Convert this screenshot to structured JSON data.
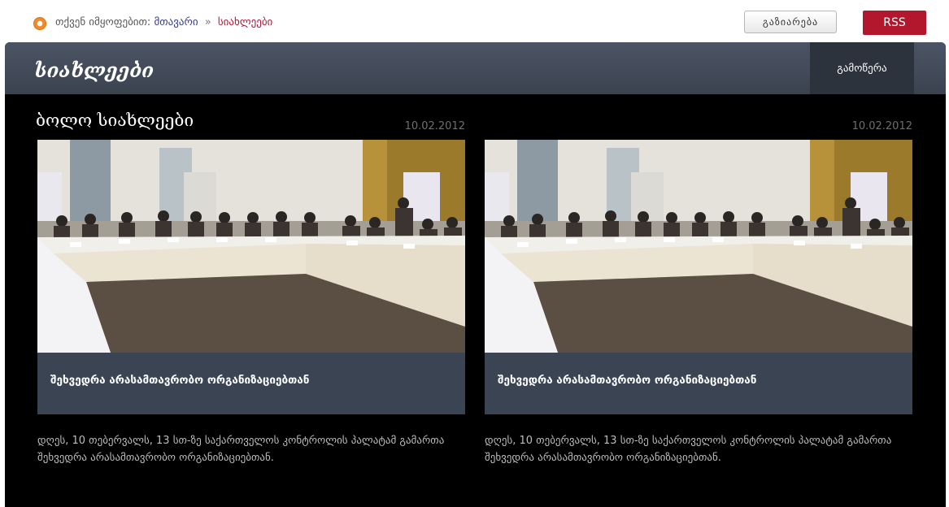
{
  "breadcrumb": {
    "prefix": "თქვენ იმყოფებით:",
    "home": "მთავარი",
    "separator": "»",
    "current": "სიახლეები"
  },
  "toolbar": {
    "share_label": "გაზიარება",
    "rss_label": "RSS"
  },
  "header": {
    "title": "სიახლეები",
    "subscribe_label": "გამოწერა"
  },
  "section": {
    "title": "ბოლო სიახლეები"
  },
  "news": [
    {
      "date": "10.02.2012",
      "title": "შეხვედრა არასამთავრობო ორგანიზაციებთან",
      "description": "დღეს, 10 თებერვალს, 13 სთ-ზე საქართველოს კონტროლის პალატამ გამართა შეხვედრა არასამთავრობო ორგანიზაციებთან."
    },
    {
      "date": "10.02.2012",
      "title": "შეხვედრა არასამთავრობო ორგანიზაციებთან",
      "description": "დღეს, 10 თებერვალს, 13 სთ-ზე საქართველოს კონტროლის პალატამ გამართა შეხვედრა არასამთავრობო ორგანიზაციებთან."
    }
  ],
  "colors": {
    "accent": "#b3172e",
    "header_bg": "#434b59",
    "card_title_bg": "#3a4453",
    "page_bg": "#000000"
  }
}
